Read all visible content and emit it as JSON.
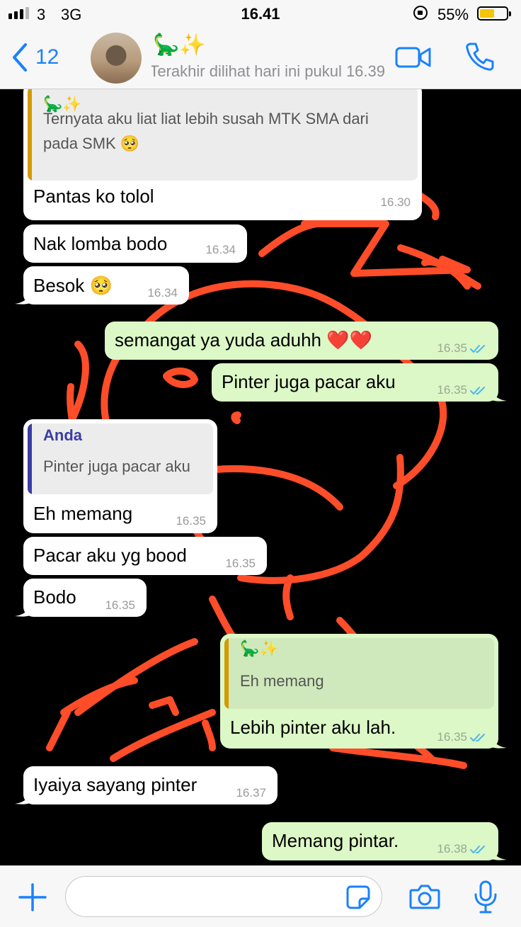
{
  "status": {
    "carrier": "3",
    "network": "3G",
    "time": "16.41",
    "battery_percent": "55%",
    "battery_level": 0.55,
    "signal_bars": 3
  },
  "header": {
    "back_count": "12",
    "contact_name": "🦕✨",
    "last_seen": "Terakhir dilihat hari ini pukul 16.39"
  },
  "messages": [
    {
      "dir": "in",
      "quote_name": "🦕✨",
      "quote_lines": [
        "Ternyata aku liat liat lebih susah MTK SMA dari",
        "pada SMK 🥺"
      ],
      "text": "Pantas ko tolol",
      "time": "16.30"
    },
    {
      "dir": "in",
      "text": "Nak lomba bodo",
      "time": "16.34"
    },
    {
      "dir": "in",
      "text": "Besok 🥺",
      "time": "16.34"
    },
    {
      "dir": "out",
      "text": "semangat ya yuda aduhh ❤️❤️",
      "time": "16.35"
    },
    {
      "dir": "out",
      "text": "Pinter juga pacar aku",
      "time": "16.35"
    },
    {
      "dir": "in",
      "quote_name": "Anda",
      "quote_lines": [
        "Pinter juga pacar aku"
      ],
      "text": "Eh memang",
      "time": "16.35"
    },
    {
      "dir": "in",
      "text": "Pacar aku yg bood",
      "time": "16.35"
    },
    {
      "dir": "in",
      "text": "Bodo",
      "time": "16.35"
    },
    {
      "dir": "out",
      "quote_name": "🦕✨",
      "quote_lines": [
        "Eh memang"
      ],
      "text": "Lebih pinter aku lah.",
      "time": "16.35"
    },
    {
      "dir": "in",
      "text": "Iyaiya sayang pinter",
      "time": "16.37"
    },
    {
      "dir": "out",
      "text": "Memang pintar.",
      "time": "16.38"
    }
  ],
  "input": {
    "placeholder": ""
  },
  "colors": {
    "accent": "#1a82fb",
    "incoming_bubble": "#ffffff",
    "outgoing_bubble": "#dcf8c6",
    "quote_bar_contact": "#d39a00",
    "quote_bar_self": "#3b3da6",
    "read_ticks": "#4fb6ec",
    "doodle": "#ff4d2a"
  },
  "icons": {
    "back": "chevron-left-icon",
    "video": "video-camera-icon",
    "call": "phone-icon",
    "attach": "plus-icon",
    "sticker": "sticker-icon",
    "camera": "camera-icon",
    "mic": "microphone-icon"
  }
}
